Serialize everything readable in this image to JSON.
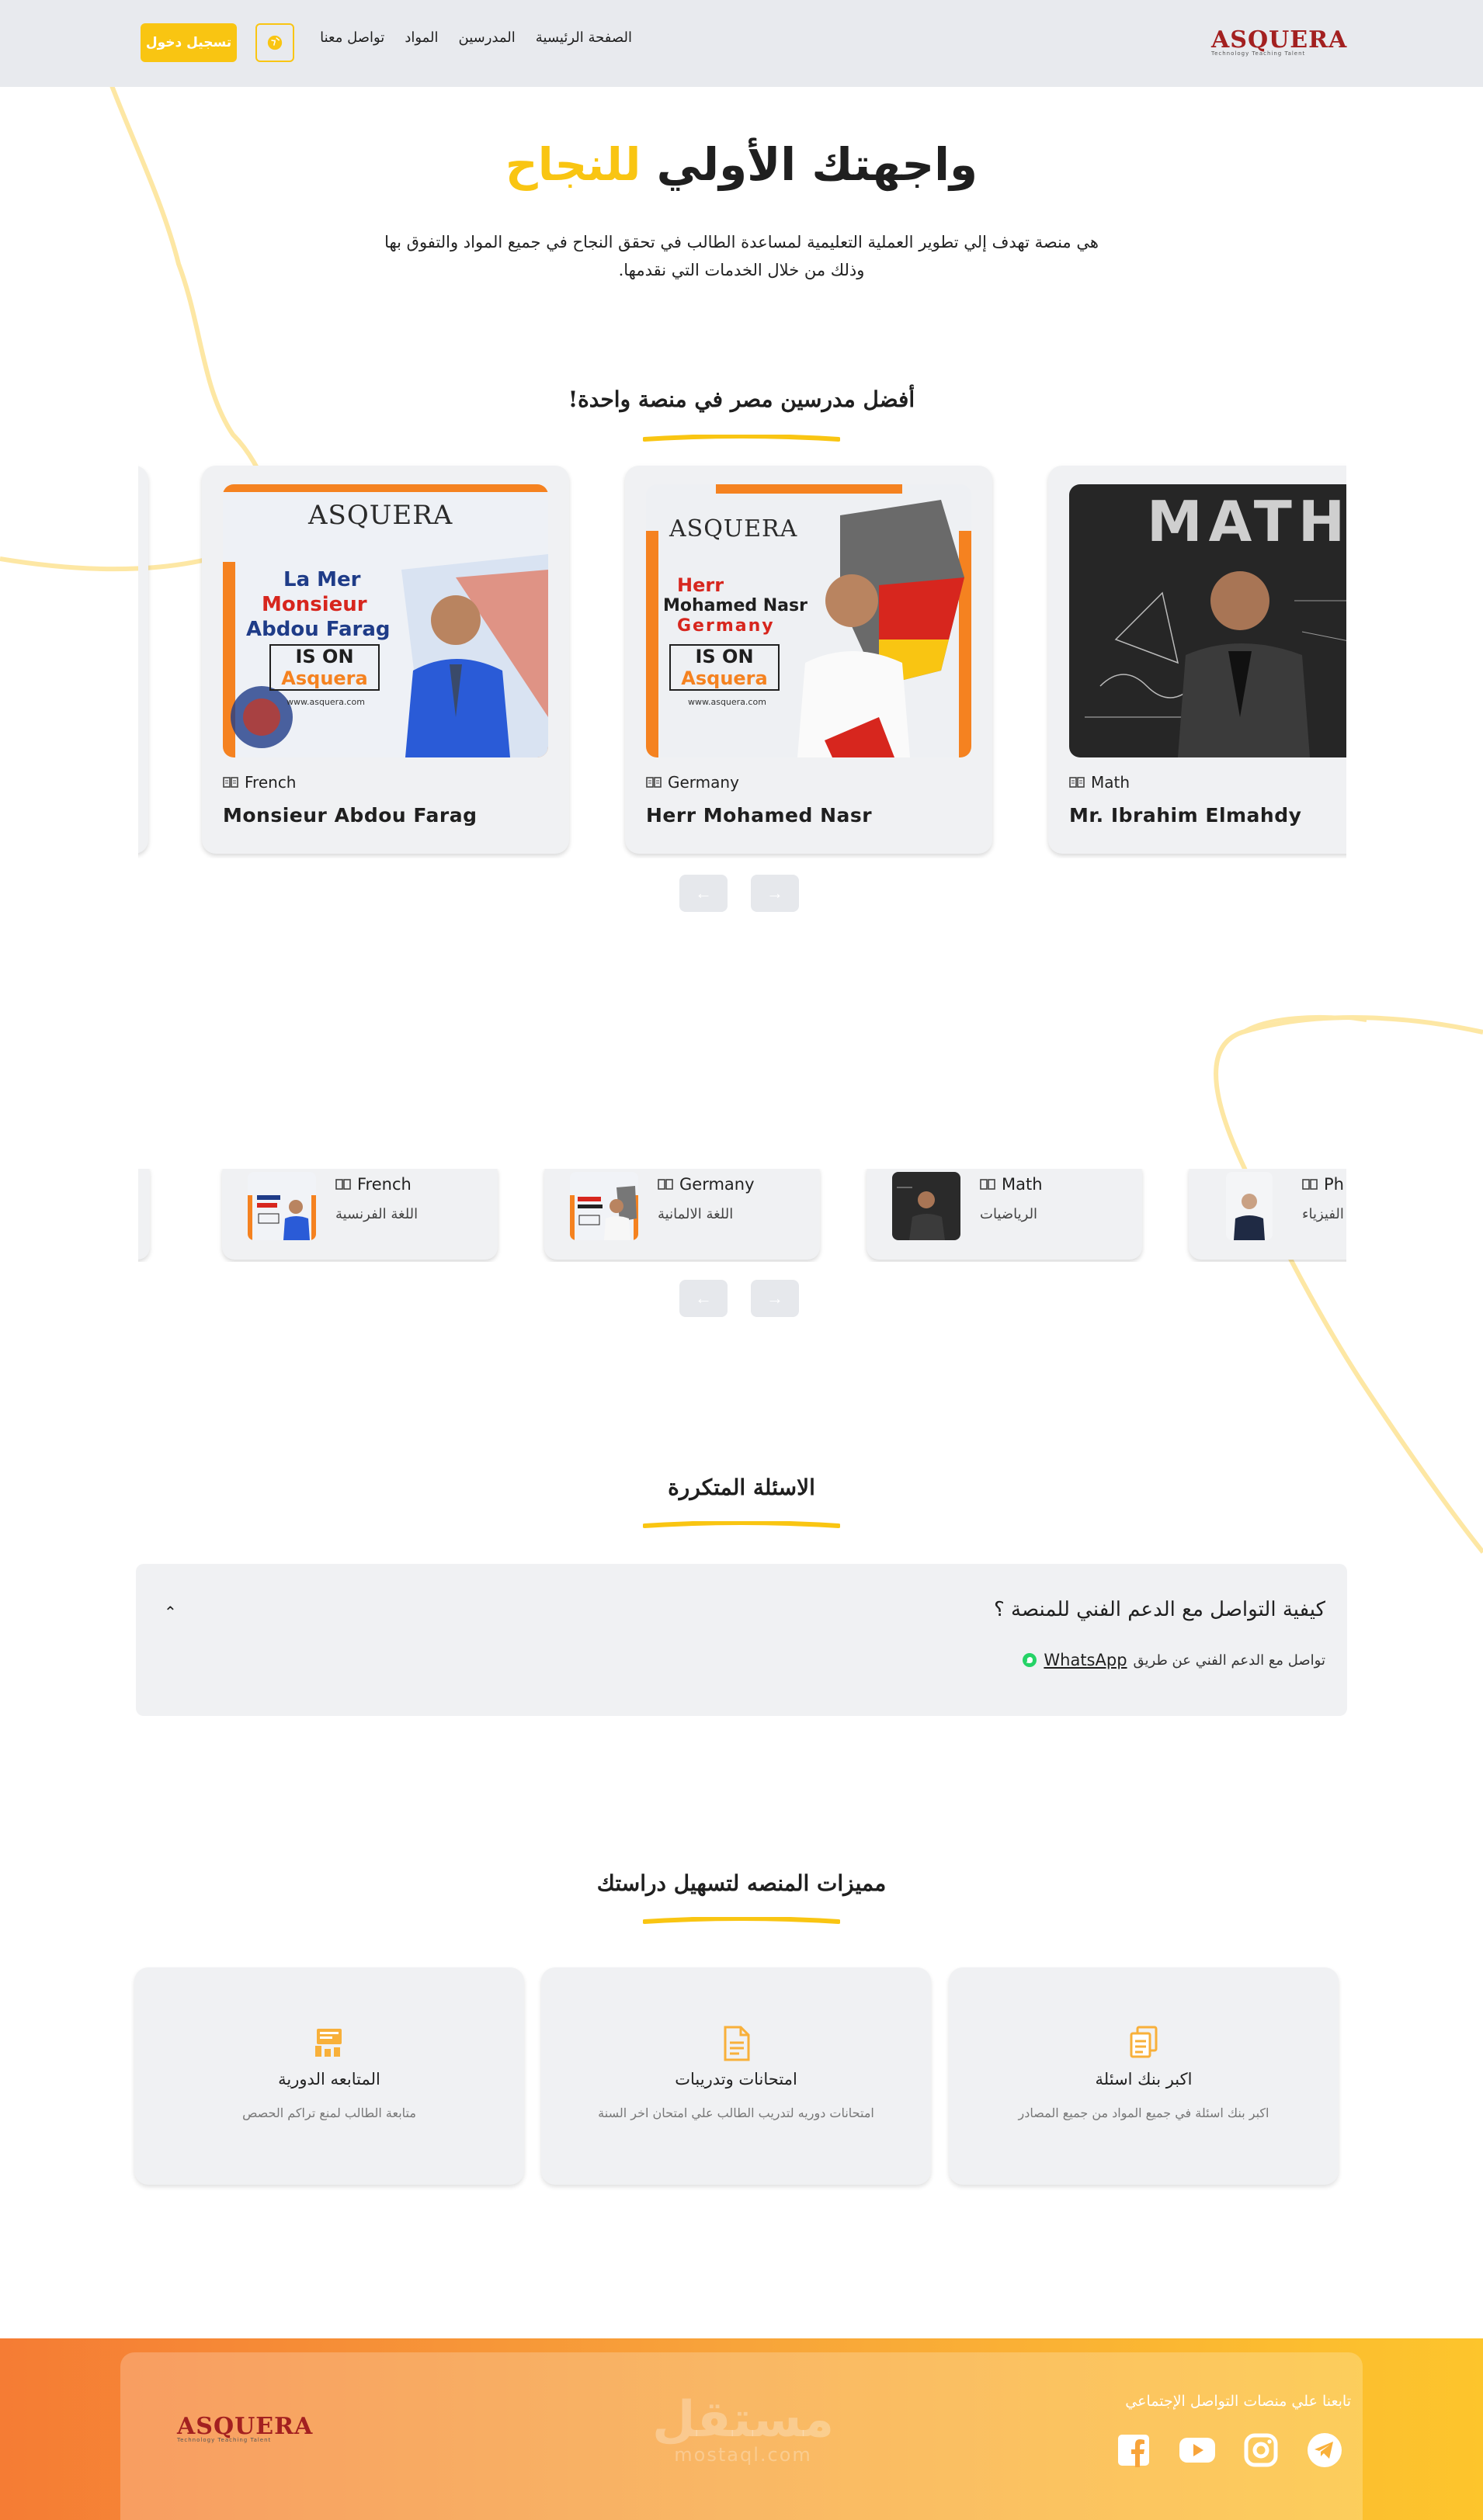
{
  "header": {
    "login_label": "تسجيل دخول",
    "nav": [
      "الصفحة الرئيسية",
      "المدرسين",
      "المواد",
      "تواصل معنا"
    ],
    "logo_text": "ASQUERA",
    "logo_tagline": "Technology Teaching Talent"
  },
  "hero": {
    "title_main": "واجهتك الأولي",
    "title_accent": "للنجاح",
    "description_line1": "هي منصة تهدف إلي تطوير العملية التعليمية لمساعدة الطالب في تحقق النجاح في جميع المواد والتفوق بها",
    "description_line2": "وذلك من خلال الخدمات التي نقدمها."
  },
  "teachers_section": {
    "title": "أفضل مدرسين مصر في منصة واحدة!",
    "cards": [
      {
        "subject": "French",
        "name": "Monsieur Abdou Farag",
        "poster_line1": "La Mer",
        "poster_line2": "Monsieur",
        "poster_line3": "Abdou Farag",
        "poster_badge1": "IS ON",
        "poster_badge2": "Asquera",
        "poster_url": "www.asquera.com"
      },
      {
        "subject": "Germany",
        "name": "Herr Mohamed Nasr",
        "poster_line1": "Herr",
        "poster_line2": "Mohamed Nasr",
        "poster_line3": "Germany",
        "poster_badge1": "IS ON",
        "poster_badge2": "Asquera",
        "poster_url": "www.asquera.com"
      },
      {
        "subject": "Math",
        "name": "Mr. Ibrahim Elmahdy",
        "poster_line1": "MATH"
      }
    ]
  },
  "subjects": [
    {
      "name": "French",
      "arabic": "اللغة الفرنسية"
    },
    {
      "name": "Germany",
      "arabic": "اللغة الالمانية"
    },
    {
      "name": "Math",
      "arabic": "الرياضيات"
    },
    {
      "name": "Ph",
      "arabic": "الفيزياء"
    }
  ],
  "faq": {
    "title": "الاسئلة المتكررة",
    "question": "كيفية التواصل مع الدعم الفني للمنصة ؟",
    "answer_prefix": "تواصل مع الدعم الفني عن طريق",
    "answer_link": "WhatsApp"
  },
  "features": {
    "title": "مميزات المنصه لتسهيل دراستك",
    "items": [
      {
        "title": "المتابعه الدورية",
        "desc": "متابعة الطالب لمنع تراكم الحصص",
        "icon": "tracking-icon"
      },
      {
        "title": "امتحانات وتدريبات",
        "desc": "امتحانات دوريه لتدريب الطالب علي امتحان اخر السنة",
        "icon": "exam-document-icon"
      },
      {
        "title": "اكبر بنك اسئلة",
        "desc": "اكبر بنك اسئلة في جميع المواد من جميع المصادر",
        "icon": "question-bank-icon"
      }
    ]
  },
  "footer": {
    "follow_text": "تابعنا علي منصات التواصل الإجتماعي",
    "watermark": "مستقل",
    "watermark_sub": "mostaql.com",
    "socials": [
      "facebook-icon",
      "youtube-icon",
      "instagram-icon",
      "telegram-icon"
    ]
  },
  "colors": {
    "accent": "#f9c512",
    "header_bg": "#e8eaee",
    "card_bg": "#f0f1f3",
    "footer_start": "#f57c34",
    "footer_end": "#fdc52c",
    "logo_red": "#a32020"
  }
}
